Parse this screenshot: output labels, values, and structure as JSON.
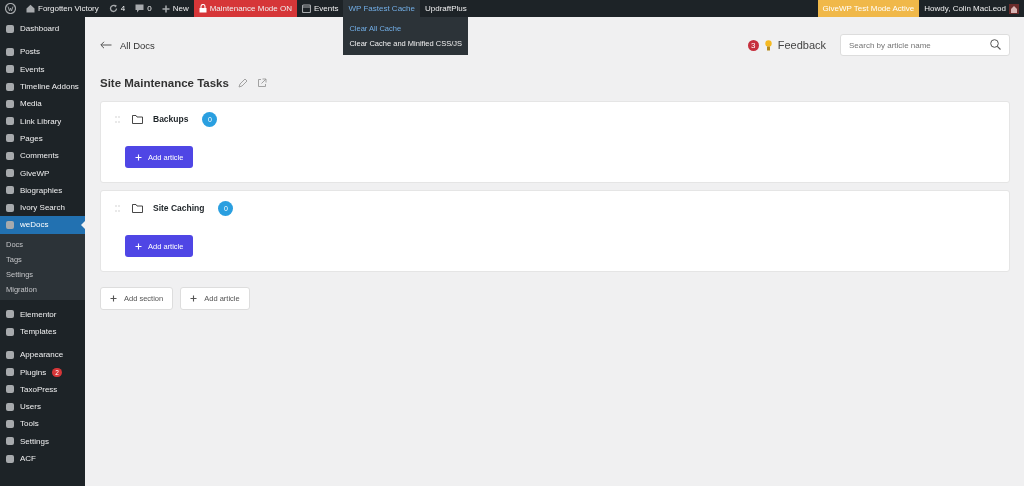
{
  "admin_bar": {
    "left": [
      {
        "kind": "logo"
      },
      {
        "kind": "site",
        "label": "Forgotten Victory"
      },
      {
        "kind": "updates",
        "label": "4"
      },
      {
        "kind": "comments",
        "label": "0"
      },
      {
        "kind": "new",
        "label": "New"
      },
      {
        "kind": "maintenance",
        "label": "Maintenance Mode ON"
      },
      {
        "kind": "events",
        "label": "Events"
      },
      {
        "kind": "plain",
        "label": "WP Fastest Cache",
        "expanded": true,
        "menu": [
          "Clear All Cache",
          "Clear Cache and Minified CSS/JS"
        ]
      },
      {
        "kind": "plain",
        "label": "UpdraftPlus",
        "expanded": false
      }
    ],
    "right": [
      {
        "kind": "notice",
        "label": "GiveWP Test Mode Active"
      },
      {
        "kind": "account",
        "label": "Howdy, Colin MacLeod"
      }
    ]
  },
  "sidebar": {
    "groups": [
      [
        {
          "label": "Dashboard",
          "selected": false
        }
      ],
      [
        {
          "label": "Posts",
          "selected": false
        },
        {
          "label": "Events",
          "selected": false
        },
        {
          "label": "Timeline Addons",
          "selected": false
        },
        {
          "label": "Media",
          "selected": false
        },
        {
          "label": "Link Library",
          "selected": false
        },
        {
          "label": "Pages",
          "selected": false
        },
        {
          "label": "Comments",
          "selected": false
        },
        {
          "label": "GiveWP",
          "selected": false
        },
        {
          "label": "Biographies",
          "selected": false
        },
        {
          "label": "Ivory Search",
          "selected": false
        },
        {
          "label": "weDocs",
          "selected": true,
          "children": [
            {
              "label": "Docs",
              "selected": false
            },
            {
              "label": "Tags",
              "selected": false
            },
            {
              "label": "Settings",
              "selected": false
            },
            {
              "label": "Migration",
              "selected": false
            }
          ]
        }
      ],
      [
        {
          "label": "Elementor",
          "selected": false
        },
        {
          "label": "Templates",
          "selected": false
        }
      ],
      [
        {
          "label": "Appearance",
          "selected": false
        },
        {
          "label": "Plugins",
          "selected": false,
          "badge": "2"
        },
        {
          "label": "TaxoPress",
          "selected": false
        },
        {
          "label": "Users",
          "selected": false
        },
        {
          "label": "Tools",
          "selected": false
        },
        {
          "label": "Settings",
          "selected": false
        },
        {
          "label": "ACF",
          "selected": false
        }
      ]
    ]
  },
  "header": {
    "back_link": "All Docs",
    "feedback_count": "3",
    "feedback": "Feedback",
    "search": {
      "placeholder": "Search by article name"
    }
  },
  "doc": {
    "title": "Site Maintenance Tasks",
    "sections": [
      {
        "title": "Backups",
        "count": "0",
        "button": "Add article"
      },
      {
        "title": "Site Caching",
        "count": "0",
        "button": "Add article"
      }
    ],
    "actions": [
      "Add section",
      "Add article"
    ]
  }
}
